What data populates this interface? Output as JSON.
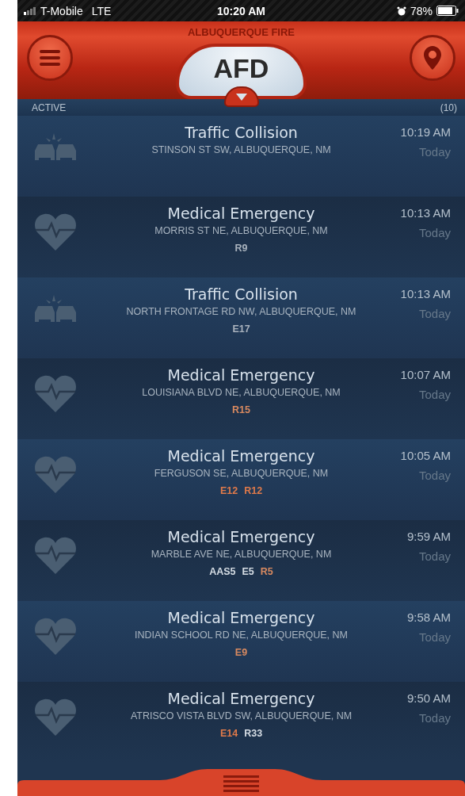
{
  "status_bar": {
    "carrier": "T-Mobile",
    "network": "LTE",
    "time": "10:20 AM",
    "battery_percent": "78%"
  },
  "header": {
    "title": "ALBUQUERQUE FIRE",
    "logo": "AFD"
  },
  "list_header": {
    "label": "ACTIVE",
    "count": "(10)"
  },
  "incidents": [
    {
      "kind": "traffic",
      "title": "Traffic Collision",
      "address": "STINSON ST SW, ALBUQUERQUE, NM",
      "time": "10:19 AM",
      "day": "Today"
    },
    {
      "kind": "medical",
      "title": "Medical Emergency",
      "address": "MORRIS ST NE, ALBUQUERQUE, NM",
      "time": "10:13 AM",
      "day": "Today",
      "units": [
        {
          "label": "R9",
          "color": "#a9b2bd"
        }
      ]
    },
    {
      "kind": "traffic",
      "title": "Traffic Collision",
      "address": "NORTH FRONTAGE RD NW, ALBUQUERQUE, NM",
      "time": "10:13 AM",
      "day": "Today",
      "units": [
        {
          "label": "E17",
          "color": "#a9b2bd"
        }
      ]
    },
    {
      "kind": "medical",
      "title": "Medical Emergency",
      "address": "LOUISIANA BLVD NE, ALBUQUERQUE, NM",
      "time": "10:07 AM",
      "day": "Today",
      "units": [
        {
          "label": "R15",
          "color": "#d98a60"
        }
      ]
    },
    {
      "kind": "medical",
      "title": "Medical Emergency",
      "address": "FERGUSON SE, ALBUQUERQUE, NM",
      "time": "10:05 AM",
      "day": "Today",
      "units": [
        {
          "label": "E12",
          "color": "#e07a4a"
        },
        {
          "label": "R12",
          "color": "#e07a4a"
        }
      ]
    },
    {
      "kind": "medical",
      "title": "Medical Emergency",
      "address": "MARBLE AVE NE, ALBUQUERQUE, NM",
      "time": "9:59 AM",
      "day": "Today",
      "units": [
        {
          "label": "AAS5",
          "color": "#d6dde4"
        },
        {
          "label": "E5",
          "color": "#d6dde4"
        },
        {
          "label": "R5",
          "color": "#d98a60"
        }
      ]
    },
    {
      "kind": "medical",
      "title": "Medical Emergency",
      "address": "INDIAN SCHOOL RD NE, ALBUQUERQUE, NM",
      "time": "9:58 AM",
      "day": "Today",
      "units": [
        {
          "label": "E9",
          "color": "#d98a60"
        }
      ]
    },
    {
      "kind": "medical",
      "title": "Medical Emergency",
      "address": "ATRISCO VISTA BLVD SW, ALBUQUERQUE, NM",
      "time": "9:50 AM",
      "day": "Today",
      "units": [
        {
          "label": "E14",
          "color": "#e07a4a"
        },
        {
          "label": "R33",
          "color": "#d6dde4"
        }
      ]
    }
  ]
}
